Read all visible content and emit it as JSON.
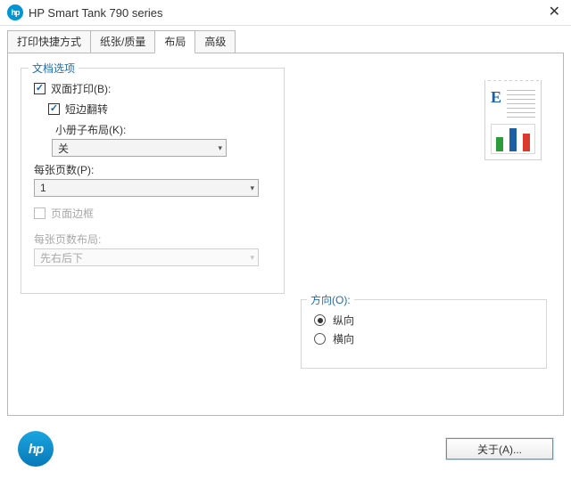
{
  "title": "HP Smart Tank 790 series",
  "tabs": {
    "t0": "打印快捷方式",
    "t1": "纸张/质量",
    "t2": "布局",
    "t3": "高级"
  },
  "doc_options": {
    "legend": "文档选项",
    "print_both_sides_label": "双面打印(B):",
    "flip_short_edge_label": "短边翻转",
    "booklet_layout_label": "小册子布局(K):",
    "booklet_layout_value": "关",
    "pages_per_sheet_label": "每张页数(P):",
    "pages_per_sheet_value": "1",
    "page_border_label": "页面边框",
    "pages_layout_label": "每张页数布局:",
    "pages_layout_value": "先右后下"
  },
  "orientation": {
    "legend": "方向(O):",
    "portrait": "纵向",
    "landscape": "横向"
  },
  "footer": {
    "about": "关于(A)..."
  }
}
